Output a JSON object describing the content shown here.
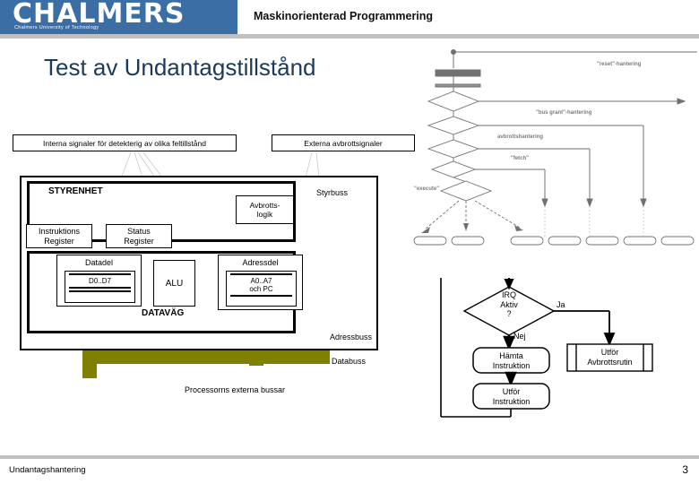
{
  "header": {
    "logo_wordmark": "CHALMERS",
    "logo_subtitle": "Chalmers University of Technology",
    "course_title": "Maskinorienterad Programmering",
    "brand_color": "#3a6ea5",
    "rule_color": "#c0c0c0"
  },
  "slide": {
    "title": "Test av Undantagstillstånd",
    "title_color": "#1b3a5c"
  },
  "cpu_diagram": {
    "signal_labels": {
      "internal": "Interna signaler för detekterig av olika feltillstånd",
      "external": "Externa avbrottsignaler"
    },
    "control_unit": {
      "title": "STYRENHET",
      "interrupt_logic": "Avbrotts-\nlogik",
      "interrupt_logic_line1": "Avbrotts-",
      "interrupt_logic_line2": "logik",
      "instruction_register_line1": "Instruktions",
      "instruction_register_line2": "Register",
      "status_register_line1": "Status",
      "status_register_line2": "Register"
    },
    "datapath": {
      "title": "DATAVÄG",
      "data_part": "Datadel",
      "data_part_range": "D0..D7",
      "alu": "ALU",
      "address_part": "Adressdel",
      "address_part_range_line1": "A0..A7",
      "address_part_range_line2": "och PC"
    },
    "buses": {
      "control": "Styrbuss",
      "address": "Adressbuss",
      "data": "Databuss",
      "caption": "Processorns externa bussar",
      "bus_color": "#808000"
    }
  },
  "petri_diagram": {
    "labels": [
      "\"reset\"-hantering",
      "\"bus grant\"-hantering",
      "avbrottshantering",
      "\"fetch\"",
      "\"execute\""
    ]
  },
  "flowchart": {
    "decision_line1": "IRQ",
    "decision_line2": "Aktiv",
    "decision_line3": "?",
    "yes_label": "Ja",
    "no_label": "Nej",
    "fetch_line1": "Hämta",
    "fetch_line2": "Instruktion",
    "execute_line1": "Utför",
    "execute_line2": "Instruktion",
    "isr_line1": "Utför",
    "isr_line2": "Avbrottsrutin"
  },
  "footer": {
    "left": "Undantagshantering",
    "page": "3"
  }
}
